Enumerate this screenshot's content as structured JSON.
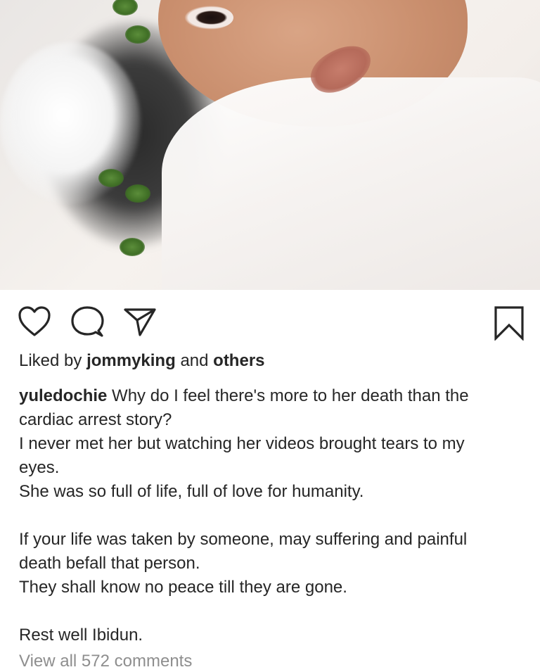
{
  "post": {
    "liked_prefix": "Liked by",
    "liked_user": "jommyking",
    "liked_and": "and",
    "liked_others": "others",
    "author": "yuledochie",
    "caption_lines": [
      "Why do I feel there's more to her death than the",
      "cardiac arrest story?",
      "I never met her but watching her videos brought tears to my",
      "eyes.",
      "She was so full of life, full of love for humanity.",
      "",
      "If your life was taken by someone, may suffering and painful",
      "death befall that person.",
      "They shall know no peace till they are gone.",
      "",
      "Rest well Ibidun."
    ],
    "view_comments": "View all 572 comments"
  },
  "icons": {
    "like": "heart-icon",
    "comment": "comment-bubble-icon",
    "share": "paper-plane-icon",
    "save": "bookmark-icon"
  },
  "colors": {
    "text": "#262626",
    "muted": "#8e8e8e",
    "background": "#ffffff"
  }
}
